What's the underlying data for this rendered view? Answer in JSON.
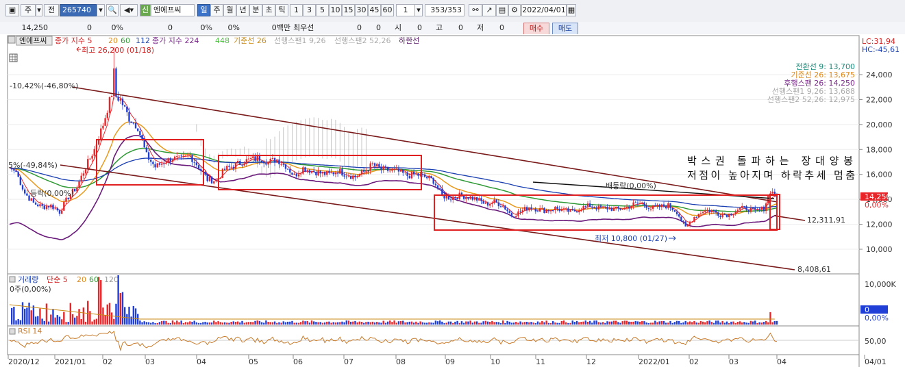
{
  "toolbar": {
    "period_label": "주",
    "prev_label": "전",
    "stock_code": "265740",
    "stock_type_badge": "신",
    "stock_name": "엔에프씨",
    "periods": [
      "일",
      "주",
      "월",
      "년",
      "분",
      "초",
      "틱"
    ],
    "intervals": [
      "1",
      "3",
      "5",
      "10",
      "15",
      "30",
      "45",
      "60"
    ],
    "count_value": "1",
    "range_display": "353/353",
    "date_value": "2022/04/01"
  },
  "infobar": {
    "price": "14,250",
    "v1": "0",
    "p1": "0%",
    "v2": "0",
    "p2": "0%",
    "p3": "0%",
    "amount": "0백만",
    "priority_label": "최우선",
    "bid": "0",
    "ask": "0",
    "open_label": "시",
    "open_value": "0",
    "high_label": "고",
    "high_value": "0",
    "low_label": "저",
    "low_value": "0",
    "buy_label": "매수",
    "sell_label": "매도"
  },
  "legend": {
    "stock": "엔에프씨",
    "ma_a_prefix": "종가 지수 5",
    "ma_a_20": "20",
    "ma_a_60": "60",
    "ma_a_112": "112",
    "ma_b_prefix": "종가 지수 224",
    "ma_b_448": "448",
    "kijun": "기준선 26",
    "span1": "선행스팬1 9,26",
    "span2": "선행스팬2 52,26",
    "lowlimit": "하한선"
  },
  "colors": {
    "up": "#e8262a",
    "down": "#1f3fd6",
    "ma5": "#e8262a",
    "ma20": "#e89a1e",
    "ma60": "#2f9a35",
    "ma112": "#1a3fb0",
    "ma224": "#7a2a8a",
    "ma448": "#4cc040",
    "kijun": "#c98a12",
    "cloud": "#b8b8b8",
    "channel": "#7a1a1a",
    "box": "#e02020",
    "bollinger": "#6a1a7a",
    "rsi": "#c87a28"
  },
  "ichimoku_legend": {
    "tenkan": "전환선 9: 13,700",
    "kijun": "기준선 26: 13,675",
    "chikou": "후행스팬 26: 14,250",
    "span1": "선행스팬1 9,26: 13,688",
    "span2": "선행스팬2 52,26: 12,975"
  },
  "scale": {
    "lc": "LC:31,94",
    "hc": "HC:-45,61",
    "current_price": "14,250",
    "current_pct": "0,00%"
  },
  "annotations": {
    "high": "최고 26,200 (01/18)",
    "low": "최저 10,800 (01/27)",
    "left_pct1": "-10,42%(-46,80%)",
    "left_pct2": "5%(-49,84%)",
    "left_pct3": "등락(0,00%)",
    "mid_label": "배등락(0,00%)",
    "channel_mid": "12,311,91",
    "channel_low": "8,408,61",
    "note_line1": "박스권 돌파하는 장대양봉",
    "note_line2": "저점이 높아지며 하락추세 멈춤"
  },
  "volume_panel": {
    "title": "거래량",
    "ma_prefix": "단순 5",
    "ma20": "20",
    "ma60": "60",
    "ma120": "120",
    "note": "0주(0,00%)",
    "axis_top": "10,000K",
    "current_value": "0",
    "current_pct": "0,00%"
  },
  "rsi_panel": {
    "title": "RSI 14",
    "level_label": "50,00"
  },
  "x_axis_labels": [
    "2020/12",
    "2021/01",
    "02",
    "03",
    "04",
    "05",
    "06",
    "07",
    "08",
    "09",
    "10",
    "11",
    "12",
    "2022/01",
    "02",
    "03",
    "04",
    "04/01"
  ],
  "chart_data": {
    "type": "candlestick",
    "y_axis_ticks": [
      10000,
      12000,
      14000,
      16000,
      18000,
      20000,
      22000,
      24000
    ],
    "y_axis_labels": [
      "10,000",
      "12,000",
      "14,000",
      "16,000",
      "18,000",
      "20,000",
      "22,000",
      "24,000"
    ],
    "ylim": [
      8000,
      25000
    ],
    "x_range": [
      "2020/12",
      "2022/04"
    ],
    "high": {
      "value": 26200,
      "date": "01/18"
    },
    "low": {
      "value": 10800,
      "date": "01/27"
    },
    "last_close": 14250,
    "price_path": [
      [
        0,
        16500
      ],
      [
        3,
        16200
      ],
      [
        7,
        14500
      ],
      [
        11,
        13700
      ],
      [
        15,
        13400
      ],
      [
        19,
        13500
      ],
      [
        23,
        13000
      ],
      [
        27,
        14200
      ],
      [
        31,
        15000
      ],
      [
        35,
        16600
      ],
      [
        39,
        18000
      ],
      [
        43,
        20000
      ],
      [
        47,
        22500
      ],
      [
        51,
        22000
      ],
      [
        55,
        20500
      ],
      [
        59,
        19800
      ],
      [
        63,
        17500
      ],
      [
        67,
        16600
      ],
      [
        71,
        17000
      ],
      [
        75,
        17300
      ],
      [
        79,
        17200
      ],
      [
        83,
        17500
      ],
      [
        87,
        16600
      ],
      [
        91,
        15600
      ],
      [
        95,
        15500
      ],
      [
        99,
        16400
      ],
      [
        103,
        16700
      ],
      [
        107,
        17000
      ],
      [
        111,
        17200
      ],
      [
        115,
        17300
      ],
      [
        119,
        17000
      ],
      [
        123,
        17200
      ],
      [
        127,
        16700
      ],
      [
        131,
        15900
      ],
      [
        135,
        16500
      ],
      [
        139,
        16300
      ],
      [
        143,
        16100
      ],
      [
        147,
        16000
      ],
      [
        151,
        16300
      ],
      [
        155,
        16000
      ],
      [
        159,
        15800
      ],
      [
        163,
        16200
      ],
      [
        167,
        16800
      ],
      [
        171,
        16400
      ],
      [
        175,
        16300
      ],
      [
        179,
        16200
      ],
      [
        183,
        15900
      ],
      [
        187,
        16000
      ],
      [
        191,
        15800
      ],
      [
        195,
        15500
      ],
      [
        199,
        14300
      ],
      [
        203,
        14100
      ],
      [
        207,
        14300
      ],
      [
        211,
        14200
      ],
      [
        215,
        14000
      ],
      [
        219,
        13600
      ],
      [
        223,
        13800
      ],
      [
        227,
        13500
      ],
      [
        231,
        12700
      ],
      [
        235,
        13000
      ],
      [
        239,
        13400
      ],
      [
        243,
        13200
      ],
      [
        247,
        13100
      ],
      [
        251,
        13300
      ],
      [
        255,
        13100
      ],
      [
        259,
        13000
      ],
      [
        263,
        13300
      ],
      [
        267,
        13500
      ],
      [
        271,
        13300
      ],
      [
        275,
        13300
      ],
      [
        279,
        13200
      ],
      [
        283,
        13300
      ],
      [
        287,
        13600
      ],
      [
        291,
        13700
      ],
      [
        295,
        13300
      ],
      [
        299,
        13400
      ],
      [
        303,
        13500
      ],
      [
        307,
        13000
      ],
      [
        311,
        11700
      ],
      [
        315,
        12600
      ],
      [
        319,
        13100
      ],
      [
        323,
        13100
      ],
      [
        327,
        12800
      ],
      [
        331,
        12800
      ],
      [
        335,
        13200
      ],
      [
        339,
        13300
      ],
      [
        343,
        13000
      ],
      [
        347,
        13300
      ],
      [
        350,
        14700
      ],
      [
        353,
        14250
      ]
    ]
  }
}
